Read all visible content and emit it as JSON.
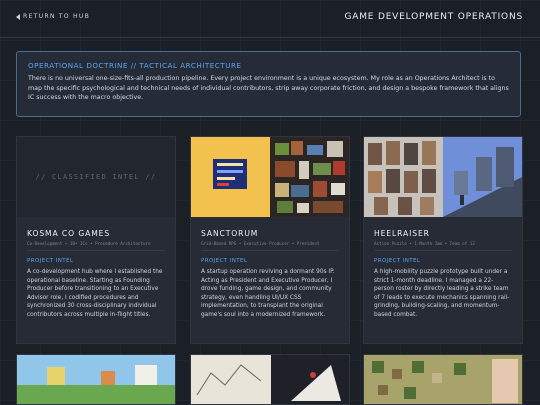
{
  "header": {
    "back_label": "RETURN TO HUB",
    "title": "GAME DEVELOPMENT OPERATIONS"
  },
  "doctrine": {
    "heading": "OPERATIONAL DOCTRINE // TACTICAL ARCHITECTURE",
    "body": "There is no universal one-size-fits-all production pipeline. Every project environment is a unique ecosystem. My role as an Operations Architect is to map the specific psychological and technical needs of individual contributors, strip away corporate friction, and design a bespoke framework that aligns IC success with the macro objective."
  },
  "cards": [
    {
      "title": "KOSMA CO GAMES",
      "meta": "Co-Development • 10+ ICs • Procedure Architecture",
      "intel_label": "PROJECT INTEL",
      "intel": "A co-development hub where I established the operational baseline. Starting as Founding Producer before transitioning to an Executive Advisor role, I codified procedures and synchronized 30 cross-disciplinary individual contributors across multiple in-flight titles.",
      "placeholder": "// CLASSIFIED INTEL //"
    },
    {
      "title": "SANCTORUM",
      "meta": "Grid-Based RPG • Executive Producer • President",
      "intel_label": "PROJECT INTEL",
      "intel": "A startup operation reviving a dormant 90s IP. Acting as President and Executive Producer, I drove funding, game design, and community strategy, even handling UI/UX CSS implementation, to transplant the original game's soul into a modernized framework."
    },
    {
      "title": "HEELRAISER",
      "meta": "Action Puzzle • 1-Month Jam • Team of 12",
      "intel_label": "PROJECT INTEL",
      "intel": "A high-mobility puzzle prototype built under a strict 1-month deadline. I managed a 22-person roster by directly leading a strike team of 7 leads to execute mechanics spanning rail-grinding, building-scaling, and momentum-based combat."
    }
  ],
  "colors": {
    "accent": "#58a6f0",
    "background": "#1b1f26",
    "card": "#262b35"
  }
}
